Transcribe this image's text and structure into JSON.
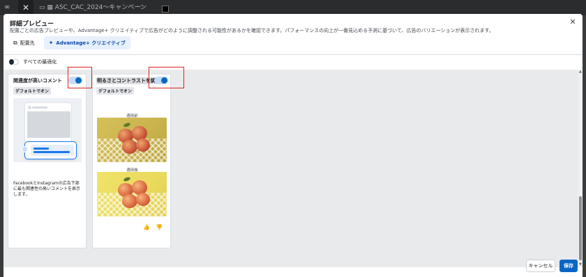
{
  "background": {
    "tab_title": "ASC_CAC_2024〜キャンペーン",
    "dots": "···"
  },
  "modal": {
    "title": "詳細プレビュー",
    "subtitle": "配置ごとの広告プレビューや、Advantage+ クリエイティブで広告がどのように調整される可能性があるかを確認できます。パフォーマンスの向上が一番見込める予測に基づいて、広告のバリエーションが表示されます。",
    "tabs": [
      {
        "label": "配置先",
        "active": false
      },
      {
        "label": "Advantage+ クリエイティブ",
        "active": true
      }
    ],
    "optimize_all_label": "すべての最適化",
    "cards": [
      {
        "title": "関連度が高いコメント",
        "badge": "デフォルトでオン",
        "toggle_on": true,
        "description": "FacebookとInstagramの広告下部に最も関連性の高いコメントを表示します。"
      },
      {
        "title": "明るさとコントラストを調整",
        "badge": "デフォルトでオン",
        "toggle_on": true,
        "before_label": "適用前",
        "after_label": "適用後"
      }
    ],
    "footer": {
      "cancel_label": "キャンセル",
      "save_label": "保存"
    }
  },
  "colors": {
    "accent": "#0a66c2",
    "highlight": "#e02020"
  }
}
